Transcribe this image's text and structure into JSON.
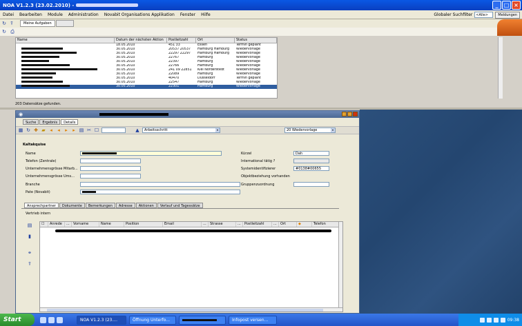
{
  "window": {
    "title": "NOA V1.2.3 (23.02.2010) -"
  },
  "menu": [
    "Datei",
    "Bearbeiten",
    "Module",
    "Administration",
    "Novabit Organisations Applikation",
    "Fenster",
    "Hilfe"
  ],
  "global_search": {
    "label": "Globaler Suchfilter",
    "value": "<Alle>",
    "button": "Meldungen"
  },
  "top_tabs": [
    "Meine Aufgaben",
    ""
  ],
  "list": {
    "columns": [
      "Name",
      "Datum der nächsten Aktion",
      "Postleitzahl",
      "Ort",
      "Status"
    ],
    "rows": [
      {
        "date": "18.05.2010",
        "plz": "451 33",
        "ort": "Essen",
        "status": "Termin geplant"
      },
      {
        "date": "30.05.2010",
        "plz": "20537 20537",
        "ort": "Hamburg Hamburg",
        "status": "Wiedervorlage"
      },
      {
        "date": "30.05.2010",
        "plz": "22297 22297",
        "ort": "Hamburg Hamburg",
        "status": "Wiedervorlage"
      },
      {
        "date": "30.05.2010",
        "plz": "22767",
        "ort": "Hamburg",
        "status": "Wiedervorlage"
      },
      {
        "date": "30.05.2010",
        "plz": "22397",
        "ort": "Hamburg",
        "status": "Wiedervorlage"
      },
      {
        "date": "30.05.2010",
        "plz": "22766",
        "ort": "Hamburg",
        "status": "Wiedervorlage"
      },
      {
        "date": "30.05.2010",
        "plz": "241 09 22851",
        "ort": "Kiel Norderstedt",
        "status": "Wiedervorlage"
      },
      {
        "date": "30.05.2010",
        "plz": "22089",
        "ort": "Hamburg",
        "status": "Wiedervorlage"
      },
      {
        "date": "30.05.2010",
        "plz": "40470",
        "ort": "Düsseldorf",
        "status": "Termin geplant"
      },
      {
        "date": "30.05.2010",
        "plz": "22547",
        "ort": "Hamburg",
        "status": "Wiedervorlage"
      },
      {
        "date": "30.05.2010",
        "plz": "22301",
        "ort": "Hamburg",
        "status": "Wiedervorlage"
      }
    ],
    "status_line": "203 Datensätze gefunden."
  },
  "detail": {
    "tabs": [
      "Suche",
      "Ergebnis",
      "Details"
    ],
    "arbeitsschritt": "Arbeitsschritt",
    "wiedervorlage": "20 Wiedervorlage",
    "section_title": "Kaltakquise",
    "labels": {
      "name": "Name",
      "telefon": "Telefon (Zentrale)",
      "ug_mitarb": "Unternehmensgrösse Mitarb...",
      "ug_umsatz": "Unternehmensgrösse Ums...",
      "branche": "Branche",
      "pate": "Pate (Novabit)",
      "kuerzel": "Kürzel",
      "international": "International tätig ?",
      "system_id": "Systemidentifizierer",
      "objekt": "Objektbeziehung vorhanden",
      "gruppen": "Gruppenzuordnung"
    },
    "values": {
      "kuerzel": "Dah",
      "system_id": "#0138#00655"
    },
    "bottom_tabs": [
      "Ansprechpartner",
      "Dokumente",
      "Bemerkungen",
      "Adresse",
      "Aktionen",
      "Verlauf und Tagessätze"
    ],
    "vertrieb_label": "Vertrieb intern",
    "grid_columns": [
      "Anrede",
      "...",
      "Vorname",
      "Name",
      "Position",
      "Email",
      "...",
      "Strasse",
      "...",
      "Postleitzahl",
      "...",
      "Ort",
      "",
      "Telefon"
    ]
  },
  "taskbar": {
    "start": "Start",
    "tasks": [
      "NOA V1.2.3 (23....",
      "Öffnung Unterfo...",
      "",
      "Infopost versen..."
    ],
    "clock": "09:38"
  }
}
